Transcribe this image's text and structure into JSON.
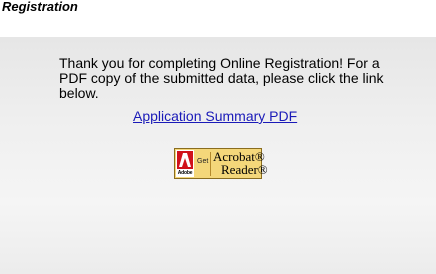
{
  "page": {
    "title": "Registration"
  },
  "content": {
    "message": "Thank you for completing Online Registration! For a PDF copy of the submitted data, please click the link below.",
    "link_label": "Application Summary PDF"
  },
  "acrobat_badge": {
    "brand": "Adobe",
    "get": "Get",
    "product_line1": "Acrobat®",
    "product_line2": "Reader®"
  },
  "colors": {
    "link": "#1a1ab8",
    "badge_background": "#f4d77a",
    "adobe_red": "#d0121b"
  }
}
